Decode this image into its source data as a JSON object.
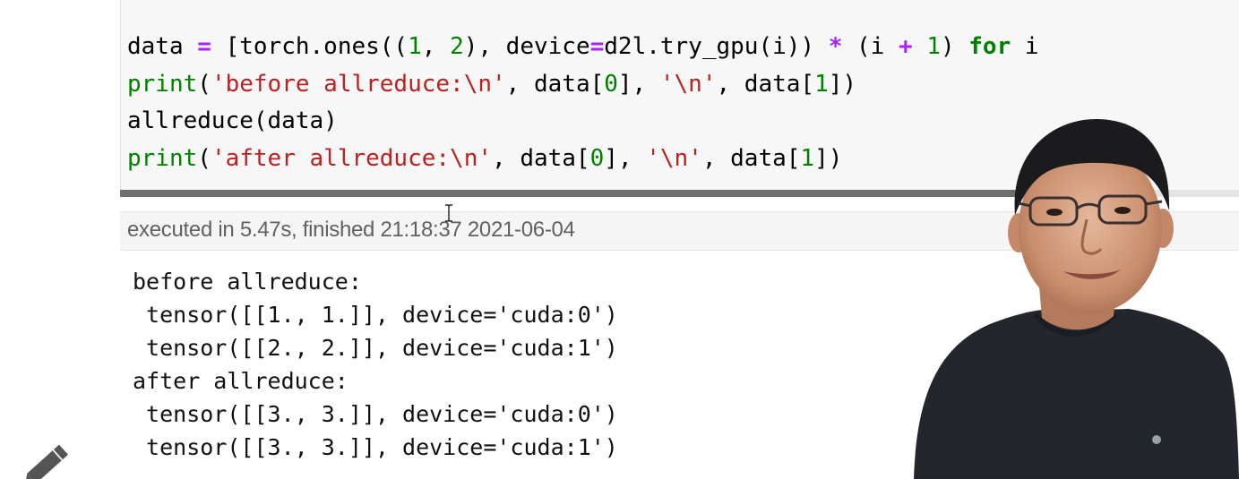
{
  "code_cell": {
    "lines": [
      [
        {
          "t": "data ",
          "c": ""
        },
        {
          "t": "=",
          "c": "op"
        },
        {
          "t": " [torch.ones((",
          "c": ""
        },
        {
          "t": "1",
          "c": "num"
        },
        {
          "t": ", ",
          "c": ""
        },
        {
          "t": "2",
          "c": "num"
        },
        {
          "t": "), device",
          "c": ""
        },
        {
          "t": "=",
          "c": "op"
        },
        {
          "t": "d2l.try_gpu(i)) ",
          "c": ""
        },
        {
          "t": "*",
          "c": "op"
        },
        {
          "t": " (i ",
          "c": ""
        },
        {
          "t": "+",
          "c": "op"
        },
        {
          "t": " ",
          "c": ""
        },
        {
          "t": "1",
          "c": "num"
        },
        {
          "t": ") ",
          "c": ""
        },
        {
          "t": "for",
          "c": "kw"
        },
        {
          "t": " i ",
          "c": ""
        }
      ],
      [
        {
          "t": "print",
          "c": "bi"
        },
        {
          "t": "(",
          "c": ""
        },
        {
          "t": "'before allreduce:\\n'",
          "c": "str"
        },
        {
          "t": ", data[",
          "c": ""
        },
        {
          "t": "0",
          "c": "num"
        },
        {
          "t": "], ",
          "c": ""
        },
        {
          "t": "'\\n'",
          "c": "str"
        },
        {
          "t": ", data[",
          "c": ""
        },
        {
          "t": "1",
          "c": "num"
        },
        {
          "t": "])",
          "c": ""
        }
      ],
      [
        {
          "t": "allreduce(data)",
          "c": ""
        }
      ],
      [
        {
          "t": "print",
          "c": "bi"
        },
        {
          "t": "(",
          "c": ""
        },
        {
          "t": "'after allreduce:\\n'",
          "c": "str"
        },
        {
          "t": ", data[",
          "c": ""
        },
        {
          "t": "0",
          "c": "num"
        },
        {
          "t": "], ",
          "c": ""
        },
        {
          "t": "'\\n'",
          "c": "str"
        },
        {
          "t": ", data[",
          "c": ""
        },
        {
          "t": "1",
          "c": "num"
        },
        {
          "t": "])",
          "c": ""
        }
      ]
    ]
  },
  "execution": {
    "status": "executed in 5.47s, finished 21:18:37 2021-06-04"
  },
  "output": {
    "lines": [
      "before allreduce:",
      " tensor([[1., 1.]], device='cuda:0')",
      " tensor([[2., 2.]], device='cuda:1')",
      "after allreduce:",
      " tensor([[3., 3.]], device='cuda:0')",
      " tensor([[3., 3.]], device='cuda:1')"
    ]
  },
  "icons": {
    "edit": "pencil-icon",
    "cursor": "text-cursor-icon",
    "presenter": "presenter-video"
  },
  "colors": {
    "operator": "#aa22ff",
    "keyword": "#008000",
    "string": "#ba2121",
    "number": "#008000"
  }
}
